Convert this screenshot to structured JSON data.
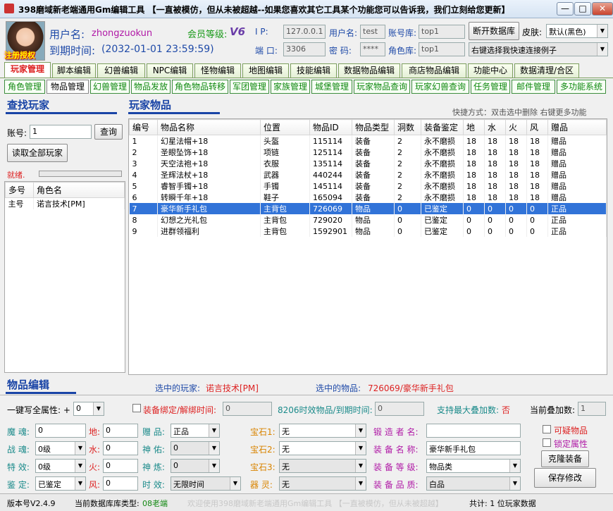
{
  "window": {
    "title": "398磨域新老端通用Gm编辑工具 【一直被模仿，但从未被超越--如果您喜欢其它工具某个功能您可以告诉我，我们立刻给您更新】",
    "min": "—",
    "max": "□",
    "close": "✕"
  },
  "header": {
    "reg_stamp": "注册授权",
    "user_label": "用户名:",
    "user_value": "zhongzuokun",
    "expire_label": "到期时间:",
    "expire_value": "(2032-01-01 23:59:59)",
    "vip_label": "会员等级:",
    "vip_value": "V6",
    "ip_label": "I    P:",
    "ip_value": "127.0.0.1",
    "port_label": "端 口:",
    "port_value": "3306",
    "dbuser_label": "用户名:",
    "dbuser_value": "test",
    "dbpass_label": "密  码:",
    "dbpass_value": "****",
    "acctdb_label": "账号库:",
    "acctdb_value": "top1",
    "roledb_label": "角色库:",
    "roledb_value": "top1",
    "disconnect_btn": "断开数据库",
    "skin_label": "皮肤:",
    "skin_value": "默认(黑色)",
    "quick_connect": "右键选择我快速连接例子"
  },
  "main_tabs": [
    "玩家管理",
    "脚本编辑",
    "幻兽编辑",
    "NPC编辑",
    "怪物编辑",
    "地图编辑",
    "技能编辑",
    "数据物品编辑",
    "商店物品编辑",
    "功能中心",
    "数据清理/合区"
  ],
  "sub_tabs": [
    "角色管理",
    "物品管理",
    "幻兽管理",
    "物品发放",
    "角色物品转移",
    "军团管理",
    "家族管理",
    "城堡管理",
    "玩家物品查询",
    "玩家幻兽查询",
    "任务管理",
    "邮件管理",
    "多功能系统"
  ],
  "find": {
    "title": "查找玩家",
    "account_label": "账号:",
    "account_value": "1",
    "query_btn": "查询",
    "read_all_btn": "读取全部玩家",
    "status": "就绪.",
    "cols": [
      "多号",
      "角色名"
    ],
    "rows": [
      [
        "主号",
        "诺言技术[PM]"
      ]
    ]
  },
  "items": {
    "title": "玩家物品",
    "hint": "快捷方式：双击选中删除 右键更多功能",
    "cols": [
      "编号",
      "物品名称",
      "位置",
      "物品ID",
      "物品类型",
      "洞数",
      "装备鉴定",
      "地",
      "水",
      "火",
      "风",
      "赠品"
    ],
    "rows": [
      [
        "1",
        "幻星法帽+18",
        "头盔",
        "115114",
        "装备",
        "2",
        "永不磨损",
        "18",
        "18",
        "18",
        "18",
        "赠品"
      ],
      [
        "2",
        "圣眼坠饰+18",
        "项链",
        "125114",
        "装备",
        "2",
        "永不磨损",
        "18",
        "18",
        "18",
        "18",
        "赠品"
      ],
      [
        "3",
        "天空法袍+18",
        "衣服",
        "135114",
        "装备",
        "2",
        "永不磨损",
        "18",
        "18",
        "18",
        "18",
        "赠品"
      ],
      [
        "4",
        "圣辉法杖+18",
        "武器",
        "440244",
        "装备",
        "2",
        "永不磨损",
        "18",
        "18",
        "18",
        "18",
        "赠品"
      ],
      [
        "5",
        "睿智手镯+18",
        "手镯",
        "145114",
        "装备",
        "2",
        "永不磨损",
        "18",
        "18",
        "18",
        "18",
        "赠品"
      ],
      [
        "6",
        "转瞬千年+18",
        "鞋子",
        "165094",
        "装备",
        "2",
        "永不磨损",
        "18",
        "18",
        "18",
        "18",
        "赠品"
      ],
      [
        "7",
        "豪华新手礼包",
        "主背包",
        "726069",
        "物品",
        "0",
        "已鉴定",
        "0",
        "0",
        "0",
        "0",
        "正品"
      ],
      [
        "8",
        "幻想之光礼包",
        "主背包",
        "729020",
        "物品",
        "0",
        "已鉴定",
        "0",
        "0",
        "0",
        "0",
        "正品"
      ],
      [
        "9",
        "进群领福利",
        "主背包",
        "1592901",
        "物品",
        "0",
        "已鉴定",
        "0",
        "0",
        "0",
        "0",
        "正品"
      ]
    ],
    "selected_row": 6
  },
  "edit": {
    "title": "物品编辑",
    "sel_player_label": "选中的玩家:",
    "sel_player_value": "诺言技术[PM]",
    "sel_item_label": "选中的物品:",
    "sel_item_value": "726069/豪华新手礼包",
    "onekey_label": "一键写全属性: +",
    "onekey_value": "0",
    "bind_label": "装备绑定/解绑时间:",
    "bind_value": "0",
    "timed_label": "8206时效物品/到期时间:",
    "timed_value": "0",
    "maxstack_label": "支持最大叠加数:",
    "maxstack_value": "否",
    "curstack_label": "当前叠加数:",
    "curstack_value": "1",
    "soul_label": "魔  魂:",
    "soul_value": "0",
    "battle_label": "战  魂:",
    "battle_value": "0级",
    "effect_label": "特  效:",
    "effect_value": "0级",
    "appraise_label": "鉴  定:",
    "appraise_value": "已鉴定",
    "earth_label": "地:",
    "earth_value": "0",
    "water_label": "水:",
    "water_value": "0",
    "fire_label": "火:",
    "fire_value": "0",
    "wind_label": "风:",
    "wind_value": "0",
    "gift_label": "赠  品:",
    "gift_value": "正品",
    "bless_label": "神  佑:",
    "bless_value": "0",
    "refine_label": "神  炼:",
    "refine_value": "0",
    "timeeff_label": "时  效:",
    "timeeff_value": "无限时间",
    "gem1_label": "宝石1:",
    "gem1_value": "无",
    "gem2_label": "宝石2:",
    "gem2_value": "无",
    "gem3_label": "宝石3:",
    "gem3_value": "无",
    "spirit_label": "器  灵:",
    "spirit_value": "无",
    "forger_label": "锻 造 者 名:",
    "forger_value": "",
    "equipname_label": "装 备 名 称:",
    "equipname_value": "豪华新手礼包",
    "equiplevel_label": "装 备 等 级:",
    "equiplevel_value": "物品类",
    "equipquality_label": "装 备 品 质:",
    "equipquality_value": "白品",
    "suspicious_label": "可疑物品",
    "lockattr_label": "锁定属性",
    "clone_btn": "克隆装备",
    "save_btn": "保存修改"
  },
  "status": {
    "version": "版本号V2.4.9",
    "dbtype_label": "当前数据库库类型:",
    "dbtype_value": "08老端",
    "marquee": "欢迎使用398磨域新老端通用Gm编辑工具 【一直被模仿，但从未被超越】",
    "total": "共计: 1 位玩家数据"
  },
  "colors": {
    "accent": "#1944a6",
    "selected_row": "#3173d8",
    "tab_green": "#118811",
    "label_red": "#d22222"
  }
}
